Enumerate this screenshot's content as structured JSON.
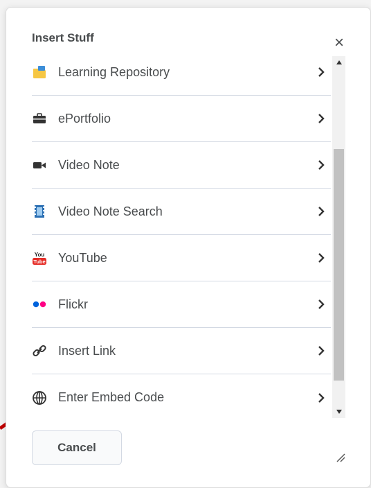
{
  "dialog": {
    "title": "Insert Stuff",
    "close_glyph": "×",
    "cancel_label": "Cancel",
    "items": [
      {
        "label": "Learning Repository",
        "icon": "learning-repository-icon"
      },
      {
        "label": "ePortfolio",
        "icon": "briefcase-icon"
      },
      {
        "label": "Video Note",
        "icon": "video-camera-icon"
      },
      {
        "label": "Video Note Search",
        "icon": "video-search-icon"
      },
      {
        "label": "YouTube",
        "icon": "youtube-icon"
      },
      {
        "label": "Flickr",
        "icon": "flickr-icon"
      },
      {
        "label": "Insert Link",
        "icon": "link-icon"
      },
      {
        "label": "Enter Embed Code",
        "icon": "globe-icon"
      }
    ]
  },
  "colors": {
    "text": "#494c4e",
    "divider": "#d3d9e3",
    "scroll_thumb": "#c1c1c1",
    "annotation_arrow": "#c00000",
    "youtube_red": "#e52d27",
    "flickr_blue": "#0063dc",
    "flickr_pink": "#ff0084"
  },
  "scrollbar": {
    "thumb_fraction": 0.64,
    "scroll_position": 0.28
  }
}
